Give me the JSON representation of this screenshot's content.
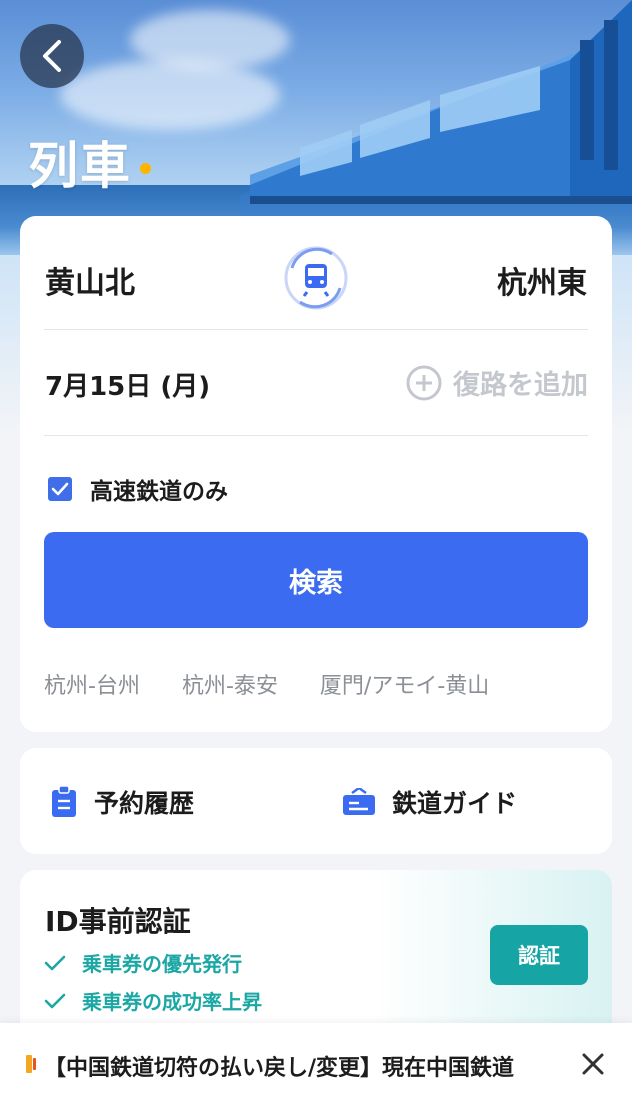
{
  "header": {
    "title": "列車"
  },
  "search": {
    "from_station": "黄山北",
    "to_station": "杭州東",
    "date": "7月15日 (月)",
    "return_label": "復路を追加",
    "high_speed_label": "高速鉄道のみ",
    "high_speed_checked": true,
    "search_button": "検索",
    "recent_routes": [
      "杭州-台州",
      "杭州-泰安",
      "厦門/アモイ-黄山"
    ]
  },
  "links": {
    "history": "予約履歴",
    "guide": "鉄道ガイド"
  },
  "id_verification": {
    "title": "ID事前認証",
    "benefits": [
      "乗車券の優先発行",
      "乗車券の成功率上昇"
    ],
    "button": "認証"
  },
  "notice": {
    "text": "【中国鉄道切符の払い戻し/変更】現在中国鉄道"
  },
  "colors": {
    "primary": "#3a6bf0",
    "teal": "#17a4a4",
    "accent_dot": "#ffb400",
    "muted": "#8b8f96"
  },
  "icons": [
    "back-arrow-icon",
    "train-swap-icon",
    "plus-circle-icon",
    "check-icon",
    "clipboard-icon",
    "ticket-icon",
    "checkmark-icon",
    "speaker-icon",
    "close-icon"
  ]
}
